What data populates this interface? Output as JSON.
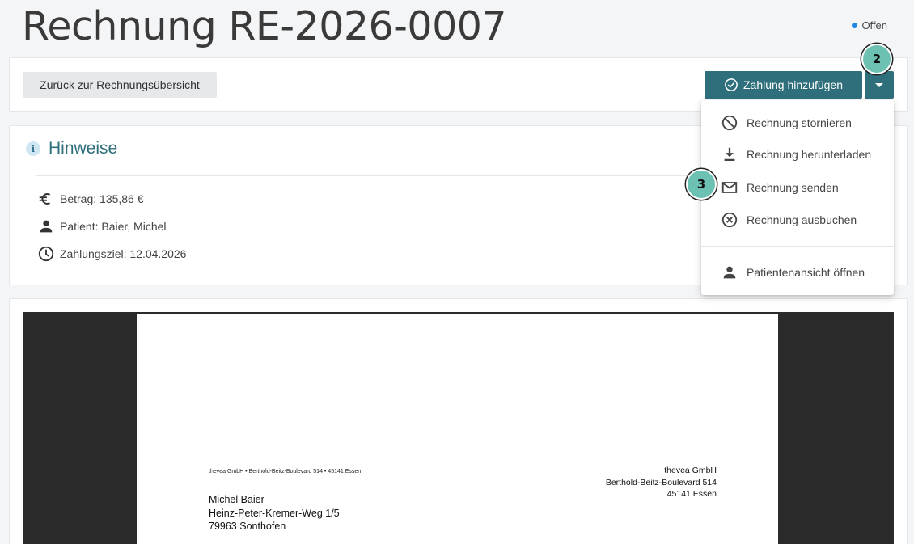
{
  "header": {
    "title": "Rechnung RE-2026-0007",
    "status_label": "Offen",
    "status_color": "#1e88e5"
  },
  "toolbar": {
    "back_label": "Zurück zur Rechnungsübersicht",
    "add_payment_label": "Zahlung hinzufügen",
    "add_payment_icon": "check-circle-icon",
    "dropdown_icon": "caret-down-icon",
    "accent_color": "#2f6f7c"
  },
  "badges": [
    "2",
    "3"
  ],
  "menu": {
    "items": [
      {
        "label": "Rechnung stornieren",
        "icon": "block-icon"
      },
      {
        "label": "Rechnung herunterladen",
        "icon": "download-icon"
      },
      {
        "label": "Rechnung senden",
        "icon": "mail-icon"
      },
      {
        "label": "Rechnung ausbuchen",
        "icon": "cancel-circle-icon"
      },
      {
        "label": "Patientenansicht öffnen",
        "icon": "person-icon"
      }
    ]
  },
  "notes": {
    "title": "Hinweise",
    "amount": "Betrag: 135,86 €",
    "patient": "Patient: Baier, Michel",
    "due": "Zahlungsziel: 12.04.2026"
  },
  "document": {
    "sender_line": "thevea GmbH • Berthold-Beitz-Boulevard 514 • 45141 Essen",
    "recipient": [
      "Michel Baier",
      "Heinz-Peter-Kremer-Weg 1/5",
      "79963 Sonthofen"
    ],
    "company": [
      "thevea GmbH",
      "Berthold-Beitz-Boulevard 514",
      "45141 Essen"
    ]
  }
}
